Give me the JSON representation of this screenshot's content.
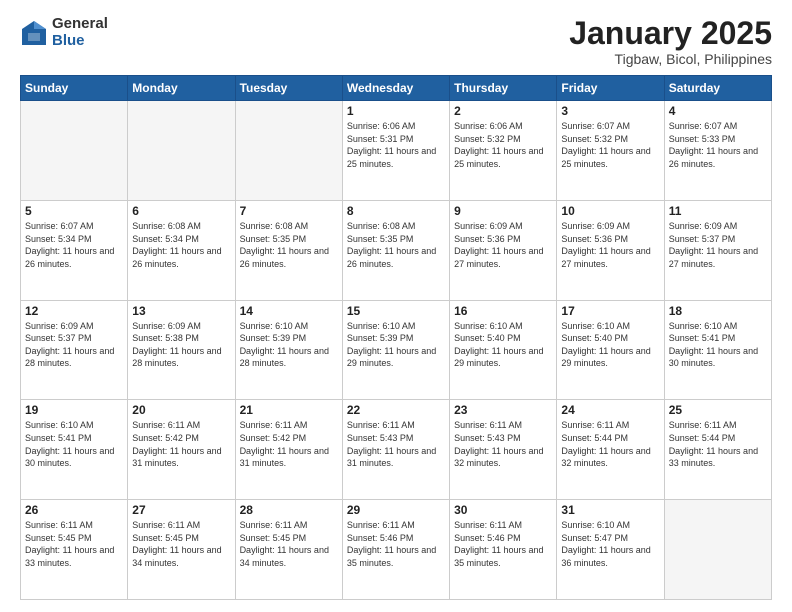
{
  "logo": {
    "general": "General",
    "blue": "Blue"
  },
  "title": {
    "month": "January 2025",
    "location": "Tigbaw, Bicol, Philippines"
  },
  "days": [
    "Sunday",
    "Monday",
    "Tuesday",
    "Wednesday",
    "Thursday",
    "Friday",
    "Saturday"
  ],
  "weeks": [
    [
      {
        "day": "",
        "text": ""
      },
      {
        "day": "",
        "text": ""
      },
      {
        "day": "",
        "text": ""
      },
      {
        "day": "1",
        "text": "Sunrise: 6:06 AM\nSunset: 5:31 PM\nDaylight: 11 hours and 25 minutes."
      },
      {
        "day": "2",
        "text": "Sunrise: 6:06 AM\nSunset: 5:32 PM\nDaylight: 11 hours and 25 minutes."
      },
      {
        "day": "3",
        "text": "Sunrise: 6:07 AM\nSunset: 5:32 PM\nDaylight: 11 hours and 25 minutes."
      },
      {
        "day": "4",
        "text": "Sunrise: 6:07 AM\nSunset: 5:33 PM\nDaylight: 11 hours and 26 minutes."
      }
    ],
    [
      {
        "day": "5",
        "text": "Sunrise: 6:07 AM\nSunset: 5:34 PM\nDaylight: 11 hours and 26 minutes."
      },
      {
        "day": "6",
        "text": "Sunrise: 6:08 AM\nSunset: 5:34 PM\nDaylight: 11 hours and 26 minutes."
      },
      {
        "day": "7",
        "text": "Sunrise: 6:08 AM\nSunset: 5:35 PM\nDaylight: 11 hours and 26 minutes."
      },
      {
        "day": "8",
        "text": "Sunrise: 6:08 AM\nSunset: 5:35 PM\nDaylight: 11 hours and 26 minutes."
      },
      {
        "day": "9",
        "text": "Sunrise: 6:09 AM\nSunset: 5:36 PM\nDaylight: 11 hours and 27 minutes."
      },
      {
        "day": "10",
        "text": "Sunrise: 6:09 AM\nSunset: 5:36 PM\nDaylight: 11 hours and 27 minutes."
      },
      {
        "day": "11",
        "text": "Sunrise: 6:09 AM\nSunset: 5:37 PM\nDaylight: 11 hours and 27 minutes."
      }
    ],
    [
      {
        "day": "12",
        "text": "Sunrise: 6:09 AM\nSunset: 5:37 PM\nDaylight: 11 hours and 28 minutes."
      },
      {
        "day": "13",
        "text": "Sunrise: 6:09 AM\nSunset: 5:38 PM\nDaylight: 11 hours and 28 minutes."
      },
      {
        "day": "14",
        "text": "Sunrise: 6:10 AM\nSunset: 5:39 PM\nDaylight: 11 hours and 28 minutes."
      },
      {
        "day": "15",
        "text": "Sunrise: 6:10 AM\nSunset: 5:39 PM\nDaylight: 11 hours and 29 minutes."
      },
      {
        "day": "16",
        "text": "Sunrise: 6:10 AM\nSunset: 5:40 PM\nDaylight: 11 hours and 29 minutes."
      },
      {
        "day": "17",
        "text": "Sunrise: 6:10 AM\nSunset: 5:40 PM\nDaylight: 11 hours and 29 minutes."
      },
      {
        "day": "18",
        "text": "Sunrise: 6:10 AM\nSunset: 5:41 PM\nDaylight: 11 hours and 30 minutes."
      }
    ],
    [
      {
        "day": "19",
        "text": "Sunrise: 6:10 AM\nSunset: 5:41 PM\nDaylight: 11 hours and 30 minutes."
      },
      {
        "day": "20",
        "text": "Sunrise: 6:11 AM\nSunset: 5:42 PM\nDaylight: 11 hours and 31 minutes."
      },
      {
        "day": "21",
        "text": "Sunrise: 6:11 AM\nSunset: 5:42 PM\nDaylight: 11 hours and 31 minutes."
      },
      {
        "day": "22",
        "text": "Sunrise: 6:11 AM\nSunset: 5:43 PM\nDaylight: 11 hours and 31 minutes."
      },
      {
        "day": "23",
        "text": "Sunrise: 6:11 AM\nSunset: 5:43 PM\nDaylight: 11 hours and 32 minutes."
      },
      {
        "day": "24",
        "text": "Sunrise: 6:11 AM\nSunset: 5:44 PM\nDaylight: 11 hours and 32 minutes."
      },
      {
        "day": "25",
        "text": "Sunrise: 6:11 AM\nSunset: 5:44 PM\nDaylight: 11 hours and 33 minutes."
      }
    ],
    [
      {
        "day": "26",
        "text": "Sunrise: 6:11 AM\nSunset: 5:45 PM\nDaylight: 11 hours and 33 minutes."
      },
      {
        "day": "27",
        "text": "Sunrise: 6:11 AM\nSunset: 5:45 PM\nDaylight: 11 hours and 34 minutes."
      },
      {
        "day": "28",
        "text": "Sunrise: 6:11 AM\nSunset: 5:45 PM\nDaylight: 11 hours and 34 minutes."
      },
      {
        "day": "29",
        "text": "Sunrise: 6:11 AM\nSunset: 5:46 PM\nDaylight: 11 hours and 35 minutes."
      },
      {
        "day": "30",
        "text": "Sunrise: 6:11 AM\nSunset: 5:46 PM\nDaylight: 11 hours and 35 minutes."
      },
      {
        "day": "31",
        "text": "Sunrise: 6:10 AM\nSunset: 5:47 PM\nDaylight: 11 hours and 36 minutes."
      },
      {
        "day": "",
        "text": ""
      }
    ]
  ]
}
